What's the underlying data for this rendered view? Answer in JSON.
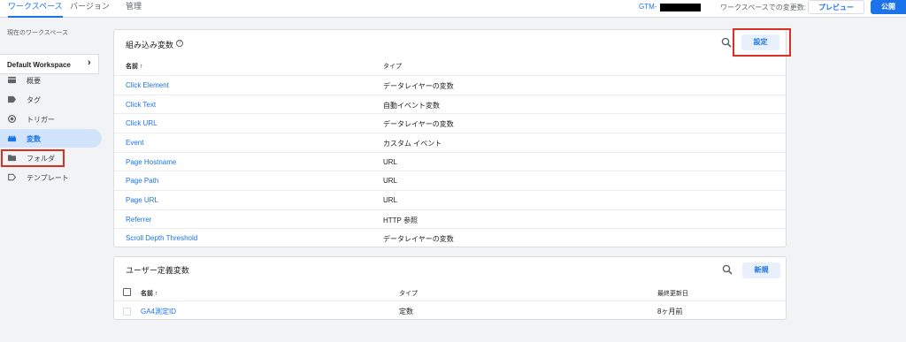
{
  "topbar": {
    "tabs": [
      {
        "label": "ワークスペース",
        "active": true
      },
      {
        "label": "バージョン",
        "active": false
      },
      {
        "label": "管理",
        "active": false
      }
    ],
    "container_id_prefix": "GTM-",
    "workspace_changes": "ワークスペースでの変更数: 0",
    "preview_label": "プレビュー",
    "publish_label": "公開"
  },
  "sidebar": {
    "current_workspace_label": "現在のワークスペース",
    "workspace_name": "Default Workspace",
    "items": [
      {
        "label": "概要",
        "icon": "overview-icon",
        "active": false
      },
      {
        "label": "タグ",
        "icon": "tag-icon",
        "active": false
      },
      {
        "label": "トリガー",
        "icon": "trigger-icon",
        "active": false
      },
      {
        "label": "変数",
        "icon": "variables-icon",
        "active": true
      },
      {
        "label": "フォルダ",
        "icon": "folder-icon",
        "active": false
      },
      {
        "label": "テンプレート",
        "icon": "template-icon",
        "active": false
      }
    ]
  },
  "builtin": {
    "title": "組み込み変数",
    "help_glyph": "?",
    "settings_label": "設定",
    "col_name": "名前 ↑",
    "col_type": "タイプ",
    "rows": [
      {
        "name": "Click Element",
        "type": "データレイヤーの変数"
      },
      {
        "name": "Click Text",
        "type": "自動イベント変数"
      },
      {
        "name": "Click URL",
        "type": "データレイヤーの変数"
      },
      {
        "name": "Event",
        "type": "カスタム イベント"
      },
      {
        "name": "Page Hostname",
        "type": "URL"
      },
      {
        "name": "Page Path",
        "type": "URL"
      },
      {
        "name": "Page URL",
        "type": "URL"
      },
      {
        "name": "Referrer",
        "type": "HTTP 参照"
      },
      {
        "name": "Scroll Depth Threshold",
        "type": "データレイヤーの変数"
      }
    ]
  },
  "user_defined": {
    "title": "ユーザー定義変数",
    "new_label": "新規",
    "col_name": "名前 ↑",
    "col_type": "タイプ",
    "col_updated": "最終更新日",
    "rows": [
      {
        "name": "GA4測定ID",
        "type": "定数",
        "updated": "8ヶ月前"
      }
    ]
  }
}
